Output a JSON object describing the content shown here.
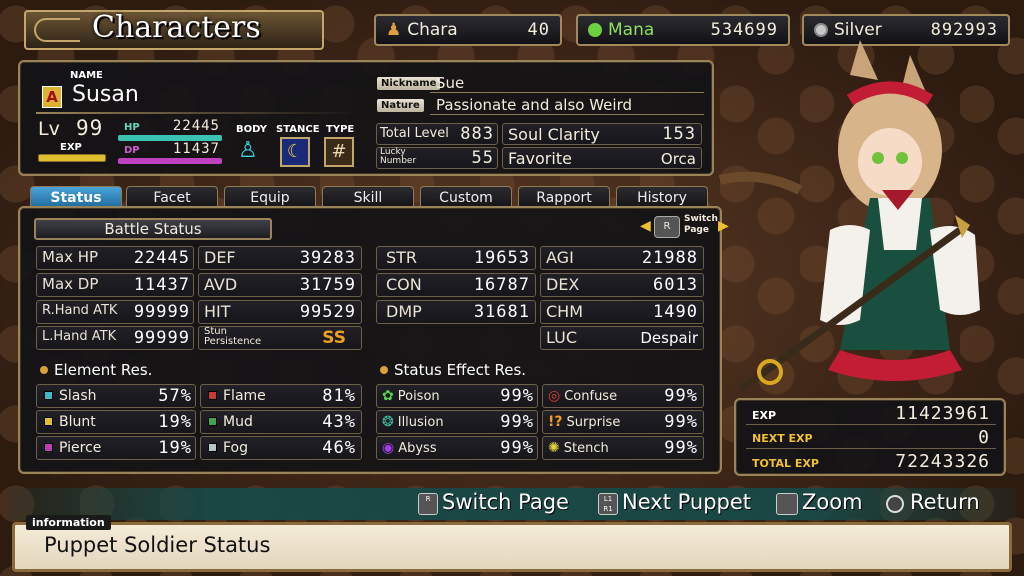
{
  "header": {
    "title": "Characters",
    "resources": [
      {
        "label": "Chara",
        "value": "40"
      },
      {
        "label": "Mana",
        "value": "534699"
      },
      {
        "label": "Silver",
        "value": "892993"
      }
    ]
  },
  "character": {
    "name_label": "NAME",
    "rank_badge": "A",
    "name": "Susan",
    "lv_label": "Lv",
    "level": "99",
    "exp_label": "EXP",
    "hp_label": "HP",
    "hp": "22445",
    "dp_label": "DP",
    "dp": "11437",
    "body_label": "BODY",
    "stance_label": "STANCE",
    "type_label": "TYPE",
    "nickname_label": "Nickname",
    "nickname": "Sue",
    "nature_label": "Nature",
    "nature": "Passionate and also Weird",
    "total_level_label": "Total Level",
    "total_level": "883",
    "soul_clarity_label": "Soul Clarity",
    "soul_clarity": "153",
    "lucky_number_label_1": "Lucky",
    "lucky_number_label_2": "Number",
    "lucky_number": "55",
    "favorite_label": "Favorite",
    "favorite": "Orca"
  },
  "tabs": [
    "Status",
    "Facet",
    "Equip",
    "Skill",
    "Custom",
    "Rapport",
    "History"
  ],
  "battle_status": {
    "title": "Battle Status",
    "switch_label_1": "Switch",
    "switch_label_2": "Page",
    "left": [
      {
        "l1": "Max HP",
        "v1": "22445",
        "l2": "DEF",
        "v2": "39283"
      },
      {
        "l1": "Max DP",
        "v1": "11437",
        "l2": "AVD",
        "v2": "31759"
      },
      {
        "l1": "R.Hand ATK",
        "v1": "99999",
        "l2": "HIT",
        "v2": "99529"
      },
      {
        "l1": "L.Hand ATK",
        "v1": "99999",
        "l2a": "Stun",
        "l2b": "Persistence",
        "v2": "SS"
      }
    ],
    "right": [
      {
        "l1": "STR",
        "v1": "19653",
        "l2": "AGI",
        "v2": "21988"
      },
      {
        "l1": "CON",
        "v1": "16787",
        "l2": "DEX",
        "v2": "6013"
      },
      {
        "l1": "DMP",
        "v1": "31681",
        "l2": "CHM",
        "v2": "1490"
      },
      {
        "l2": "LUC",
        "v2": "Despair"
      }
    ]
  },
  "element_res": {
    "title": "Element Res.",
    "items": [
      {
        "name": "Slash",
        "value": "57%",
        "color": "#3fb8c8"
      },
      {
        "name": "Flame",
        "value": "81%",
        "color": "#c83a30"
      },
      {
        "name": "Blunt",
        "value": "19%",
        "color": "#e0c030"
      },
      {
        "name": "Mud",
        "value": "43%",
        "color": "#3aa84a"
      },
      {
        "name": "Pierce",
        "value": "19%",
        "color": "#c03ab8"
      },
      {
        "name": "Fog",
        "value": "46%",
        "color": "#b8c4c8"
      }
    ]
  },
  "status_effect_res": {
    "title": "Status Effect Res.",
    "items": [
      {
        "name": "Poison",
        "value": "99%",
        "icon": "poison-icon"
      },
      {
        "name": "Confuse",
        "value": "99%",
        "icon": "confuse-icon"
      },
      {
        "name": "Illusion",
        "value": "99%",
        "icon": "illusion-icon"
      },
      {
        "name": "Surprise",
        "value": "99%",
        "icon": "surprise-icon"
      },
      {
        "name": "Abyss",
        "value": "99%",
        "icon": "abyss-icon"
      },
      {
        "name": "Stench",
        "value": "99%",
        "icon": "stench-icon"
      }
    ]
  },
  "exp": {
    "exp_label": "EXP",
    "exp": "11423961",
    "next_label": "NEXT EXP",
    "next": "0",
    "total_label": "TOTAL EXP",
    "total": "72243326"
  },
  "controls": {
    "switch_page": "Switch Page",
    "next_puppet": "Next Puppet",
    "zoom": "Zoom",
    "return": "Return",
    "r_key": "R",
    "l1_key": "L1",
    "r1_key": "R1"
  },
  "info": {
    "label": "information",
    "text": "Puppet Soldier Status"
  }
}
